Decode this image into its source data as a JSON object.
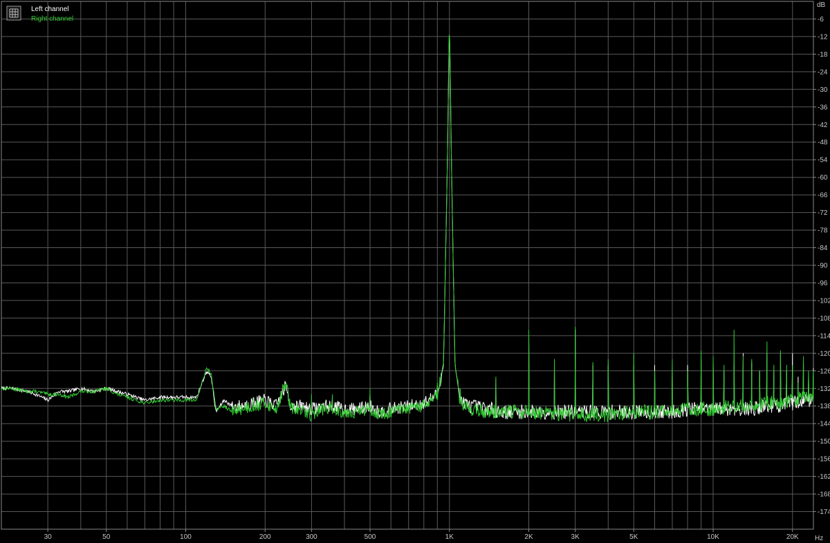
{
  "chart_data": {
    "type": "line",
    "title": "",
    "xlabel": "Hz",
    "ylabel": "dB",
    "xscale": "log",
    "xlim": [
      20,
      24000
    ],
    "ylim": [
      -180,
      0
    ],
    "grid": true,
    "legend_position": "top-left",
    "x_ticks": [
      {
        "value": 30,
        "label": "30"
      },
      {
        "value": 50,
        "label": "50"
      },
      {
        "value": 100,
        "label": "100"
      },
      {
        "value": 200,
        "label": "200"
      },
      {
        "value": 300,
        "label": "300"
      },
      {
        "value": 500,
        "label": "500"
      },
      {
        "value": 1000,
        "label": "1K"
      },
      {
        "value": 2000,
        "label": "2K"
      },
      {
        "value": 3000,
        "label": "3K"
      },
      {
        "value": 5000,
        "label": "5K"
      },
      {
        "value": 10000,
        "label": "10K"
      },
      {
        "value": 20000,
        "label": "20K"
      }
    ],
    "y_ticks": [
      -6,
      -12,
      -18,
      -24,
      -30,
      -36,
      -42,
      -48,
      -54,
      -60,
      -66,
      -72,
      -78,
      -84,
      -90,
      -96,
      -102,
      -108,
      -114,
      -120,
      -126,
      -132,
      -138,
      -144,
      -150,
      -156,
      -162,
      -168,
      -174
    ],
    "series": [
      {
        "name": "Left channel",
        "color": "#ffffff",
        "x": [
          20,
          22,
          25,
          27,
          30,
          33,
          36,
          40,
          45,
          50,
          55,
          60,
          70,
          80,
          90,
          100,
          110,
          120,
          125,
          130,
          140,
          150,
          160,
          180,
          200,
          220,
          240,
          250,
          260,
          280,
          300,
          330,
          360,
          400,
          450,
          500,
          550,
          600,
          700,
          800,
          900,
          950,
          980,
          1000,
          1020,
          1050,
          1100,
          1200,
          1400,
          1600,
          2000,
          2500,
          3000,
          4000,
          5000,
          6000,
          7000,
          8000,
          10000,
          12000,
          14000,
          16000,
          18000,
          20000,
          22000,
          24000
        ],
        "y": [
          -132,
          -132,
          -133,
          -134,
          -136,
          -133,
          -133,
          -132,
          -133,
          -132,
          -133,
          -134,
          -136,
          -135,
          -135,
          -135,
          -135,
          -126,
          -128,
          -140,
          -136,
          -138,
          -138,
          -137,
          -136,
          -138,
          -131,
          -138,
          -138,
          -138,
          -139,
          -138,
          -138,
          -139,
          -139,
          -138,
          -140,
          -139,
          -138,
          -137,
          -134,
          -124,
          -60,
          -6,
          -60,
          -124,
          -136,
          -138,
          -139,
          -140,
          -140,
          -140,
          -140,
          -140,
          -140,
          -140,
          -140,
          -139,
          -139,
          -139,
          -139,
          -138,
          -138,
          -137,
          -136,
          -136
        ]
      },
      {
        "name": "Right channel",
        "color": "#33cc33",
        "x": [
          20,
          22,
          25,
          27,
          30,
          33,
          36,
          40,
          45,
          50,
          55,
          60,
          70,
          80,
          90,
          100,
          110,
          120,
          125,
          130,
          140,
          150,
          160,
          180,
          200,
          220,
          240,
          250,
          260,
          280,
          300,
          330,
          360,
          400,
          450,
          500,
          550,
          600,
          700,
          800,
          900,
          950,
          980,
          1000,
          1020,
          1050,
          1100,
          1200,
          1400,
          1600,
          2000,
          2500,
          3000,
          4000,
          5000,
          6000,
          7000,
          8000,
          10000,
          12000,
          14000,
          16000,
          18000,
          20000,
          22000,
          24000
        ],
        "y": [
          -132,
          -132,
          -133,
          -133,
          -134,
          -134,
          -135,
          -133,
          -133,
          -132,
          -134,
          -135,
          -137,
          -136,
          -136,
          -136,
          -136,
          -125,
          -127,
          -139,
          -138,
          -140,
          -139,
          -138,
          -137,
          -139,
          -130,
          -139,
          -139,
          -140,
          -141,
          -139,
          -139,
          -140,
          -140,
          -139,
          -141,
          -140,
          -139,
          -138,
          -135,
          -123,
          -60,
          -5,
          -60,
          -124,
          -137,
          -139,
          -140,
          -140,
          -140,
          -141,
          -141,
          -141,
          -140,
          -140,
          -140,
          -139,
          -139,
          -138,
          -138,
          -137,
          -137,
          -136,
          -135,
          -134
        ]
      }
    ],
    "spikes": {
      "freqs": [
        120,
        180,
        240,
        300,
        360,
        500,
        900,
        1100,
        1500,
        2000,
        2500,
        3000,
        3500,
        4000,
        5000,
        6000,
        7000,
        8000,
        9000,
        10000,
        11000,
        12000,
        13000,
        14000,
        15000,
        16000,
        17000,
        18000,
        19000,
        20000,
        21000,
        22000,
        23000,
        24000
      ],
      "left": [
        -127,
        -136,
        -131,
        -136,
        -136,
        -134,
        -131,
        -134,
        -129,
        -113,
        -124,
        -112,
        -124,
        -124,
        -124,
        -124,
        -124,
        -124,
        -122,
        -122,
        -126,
        -124,
        -120,
        -123,
        -126,
        -120,
        -126,
        -120,
        -126,
        -120,
        -128,
        -124,
        -128,
        -125
      ],
      "right": [
        -125,
        -135,
        -130,
        -134,
        -134,
        -132,
        -130,
        -132,
        -128,
        -112,
        -122,
        -111,
        -123,
        -122,
        -120,
        -126,
        -122,
        -126,
        -119,
        -121,
        -124,
        -112,
        -121,
        -122,
        -126,
        -116,
        -124,
        -119,
        -124,
        -124,
        -130,
        -121,
        -126,
        -126
      ]
    }
  }
}
